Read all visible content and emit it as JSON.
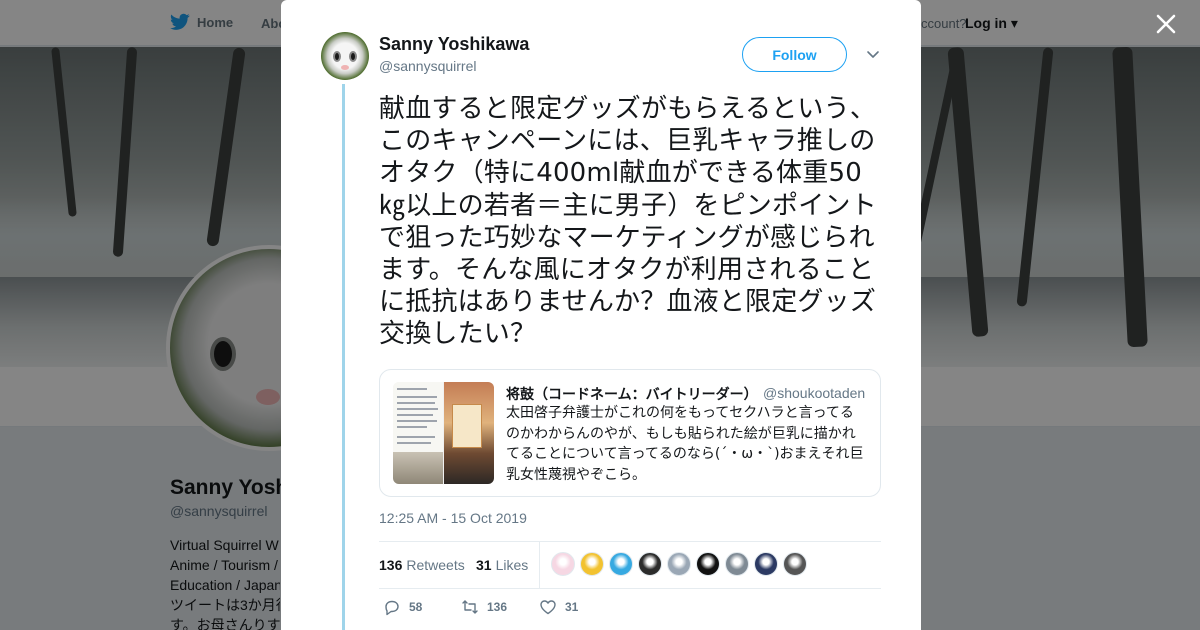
{
  "nav": {
    "home_label": "Home",
    "about_label": "Abo",
    "account_prompt": "ccount?",
    "login_label": "Log in ▾"
  },
  "profile": {
    "name": "Sanny Yosh",
    "handle": "@sannysquirrel",
    "bio_lines": [
      "Virtual Squirrel W",
      "Anime / Tourism /",
      "Education / Japan",
      "ツイートは3か月行",
      "す。お母さんりす"
    ]
  },
  "tweet": {
    "author_name": "Sanny Yoshikawa",
    "author_handle": "@sannysquirrel",
    "follow_label": "Follow",
    "text": "献血すると限定グッズがもらえるという、このキャンペーンには、巨乳キャラ推しのオタク（特に400ml献血ができる体重50㎏以上の若者＝主に男子）をピンポイントで狙った巧妙なマーケティングが感じられます。そんな風にオタクが利用されることに抵抗はありませんか？血液と限定グッズ交換したい？",
    "timestamp": "12:25 AM - 15 Oct 2019",
    "quoted": {
      "author_name": "将鼓（コードネーム：バイトリーダー）",
      "author_handle": "@shoukootaden",
      "text": "太田啓子弁護士がこれの何をもってセクハラと言ってるのかわからんのやが、もしも貼られた絵が巨乳に描かれてることについて言ってるのなら(´・ω・`)おまえそれ巨乳女性蔑視やぞこら。"
    },
    "stats": {
      "retweets_count": "136",
      "retweets_label": "Retweets",
      "likes_count": "31",
      "likes_label": "Likes"
    },
    "actions": {
      "reply_count": "58",
      "retweet_count": "136",
      "like_count": "31"
    },
    "liker_avatar_colors": [
      "#f6d7e3",
      "#f2c230",
      "#36a9e1",
      "#2b2b2b",
      "#9aa7b5",
      "#111111",
      "#7f8a94",
      "#2c3a63",
      "#555555"
    ]
  },
  "colors": {
    "accent": "#1da1f2",
    "thread_line": "#9fd4ea",
    "secondary_text": "#657786"
  }
}
